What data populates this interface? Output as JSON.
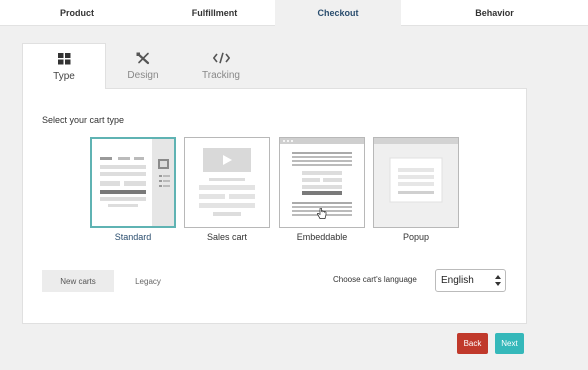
{
  "top_tabs": [
    {
      "label": "Product"
    },
    {
      "label": "Fulfillment"
    },
    {
      "label": "Checkout"
    },
    {
      "label": "Behavior"
    }
  ],
  "sub_tabs": [
    {
      "label": "Type",
      "icon": "grid-icon"
    },
    {
      "label": "Design",
      "icon": "design-tools-icon"
    },
    {
      "label": "Tracking",
      "icon": "code-icon"
    }
  ],
  "prompt": "Select your cart type",
  "cart_types": [
    {
      "label": "Standard",
      "selected": true
    },
    {
      "label": "Sales cart",
      "selected": false
    },
    {
      "label": "Embeddable",
      "selected": false
    },
    {
      "label": "Popup",
      "selected": false
    }
  ],
  "version_toggle": {
    "new_label": "New carts",
    "legacy_label": "Legacy"
  },
  "language": {
    "label": "Choose cart's language",
    "value": "English"
  },
  "actions": {
    "back_label": "Back",
    "next_label": "Next"
  },
  "colors": {
    "accent": "#35b8ba",
    "back": "#c0392b",
    "selected_border": "#5fb3b3",
    "active_text": "#2a4d6e"
  }
}
